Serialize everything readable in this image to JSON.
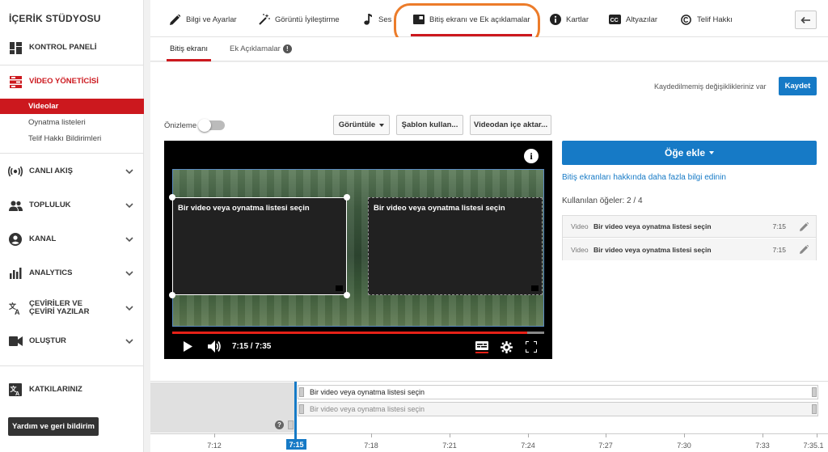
{
  "sidebar": {
    "title": "İÇERİK STÜDYOSU",
    "dashboard": "KONTROL PANELİ",
    "video_manager": "VİDEO YÖNETİCİSİ",
    "sub_items": [
      "Videolar",
      "Oynatma listeleri",
      "Telif Hakkı Bildirimleri"
    ],
    "live": "CANLI AKIŞ",
    "community": "TOPLULUK",
    "channel": "KANAL",
    "analytics": "ANALYTICS",
    "translations": "ÇEVİRİLER VE ÇEVİRİ YAZILAR",
    "create": "OLUŞTUR",
    "contributions": "KATKILARINIZ",
    "help_button": "Yardım ve geri bildirim"
  },
  "tabs": {
    "info": "Bilgi ve Ayarlar",
    "enhance": "Görüntü İyileştirme",
    "audio": "Ses",
    "end_screen": "Bitiş ekranı ve Ek açıklamalar",
    "cards": "Kartlar",
    "subtitles": "Altyazılar",
    "copyright": "Telif Hakkı"
  },
  "subtabs": {
    "end_screen": "Bitiş ekranı",
    "annotations": "Ek Açıklamalar",
    "info_glyph": "!"
  },
  "toolbar": {
    "unsaved": "Kaydedilmemiş değişiklikleriniz var",
    "save": "Kaydet",
    "preview": "Önizleme",
    "preview_on": false,
    "view": "Görüntüle",
    "use_template": "Şablon kullan...",
    "import_video": "Videodan içe aktar..."
  },
  "video": {
    "element_text": "Bir video veya oynatma listesi seçin",
    "time": "7:15 / 7:35",
    "progress": 0.955,
    "info_glyph": "i"
  },
  "panel": {
    "add_element": "Öğe ekle",
    "learn_more": "Bitiş ekranları hakkında daha fazla bilgi edinin",
    "used": "Kullanılan öğeler: 2 / 4",
    "elements": [
      {
        "type": "Video",
        "name": "Bir video veya oynatma listesi seçin",
        "duration": "7:15"
      },
      {
        "type": "Video",
        "name": "Bir video veya oynatma listesi seçin",
        "duration": "7:15"
      }
    ]
  },
  "timeline": {
    "tracks": [
      "Bir video veya oynatma listesi seçin",
      "Bir video veya oynatma listesi seçin"
    ],
    "ticks": [
      "7:12",
      "7:18",
      "7:21",
      "7:24",
      "7:27",
      "7:30",
      "7:33",
      "7:35.1"
    ],
    "playhead": "7:15",
    "help_glyph": "?"
  },
  "colors": {
    "accent_red": "#cc181e",
    "primary_blue": "#167ac6",
    "highlight_orange": "#ec7c2a"
  }
}
